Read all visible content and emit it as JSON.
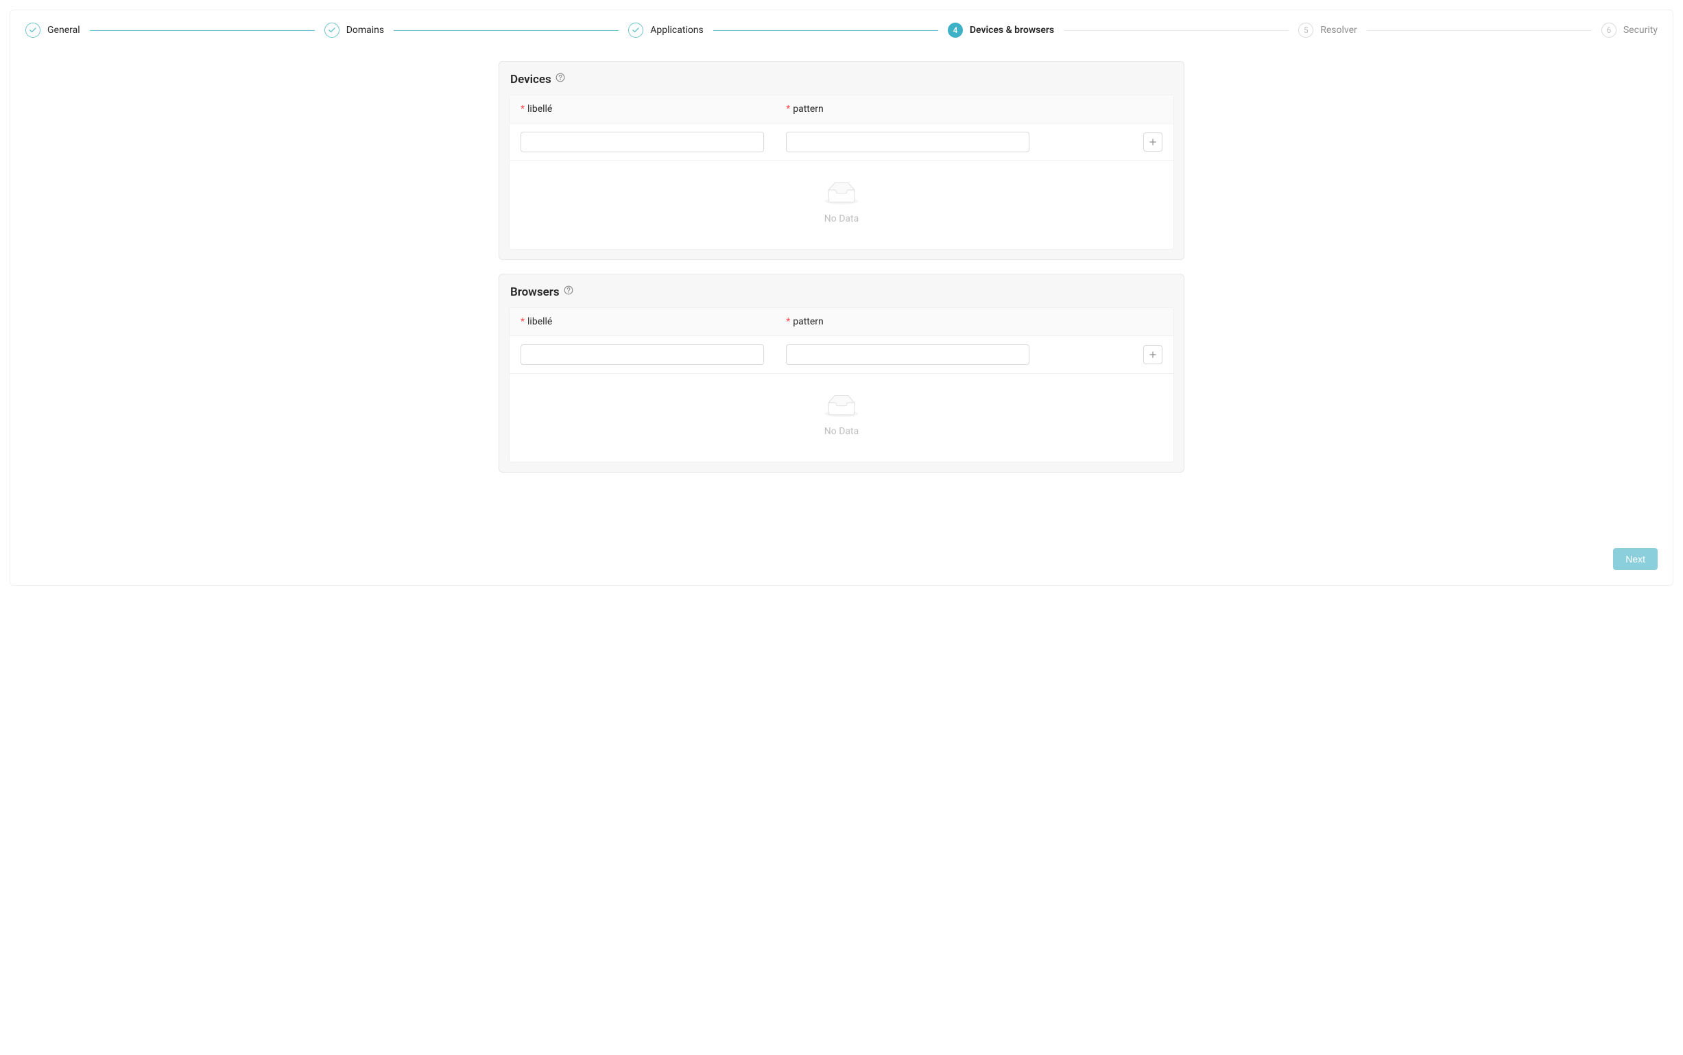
{
  "stepper": {
    "steps": [
      {
        "num": "1",
        "label": "General",
        "state": "done"
      },
      {
        "num": "2",
        "label": "Domains",
        "state": "done"
      },
      {
        "num": "3",
        "label": "Applications",
        "state": "done"
      },
      {
        "num": "4",
        "label": "Devices & browsers",
        "state": "current"
      },
      {
        "num": "5",
        "label": "Resolver",
        "state": "pending"
      },
      {
        "num": "6",
        "label": "Security",
        "state": "pending"
      }
    ]
  },
  "sections": {
    "devices": {
      "title": "Devices",
      "columns": {
        "libelle": "libellé",
        "pattern": "pattern"
      },
      "inputs": {
        "libelle": "",
        "pattern": ""
      },
      "empty_text": "No Data"
    },
    "browsers": {
      "title": "Browsers",
      "columns": {
        "libelle": "libellé",
        "pattern": "pattern"
      },
      "inputs": {
        "libelle": "",
        "pattern": ""
      },
      "empty_text": "No Data"
    }
  },
  "footer": {
    "next_label": "Next"
  },
  "required_mark": "*"
}
